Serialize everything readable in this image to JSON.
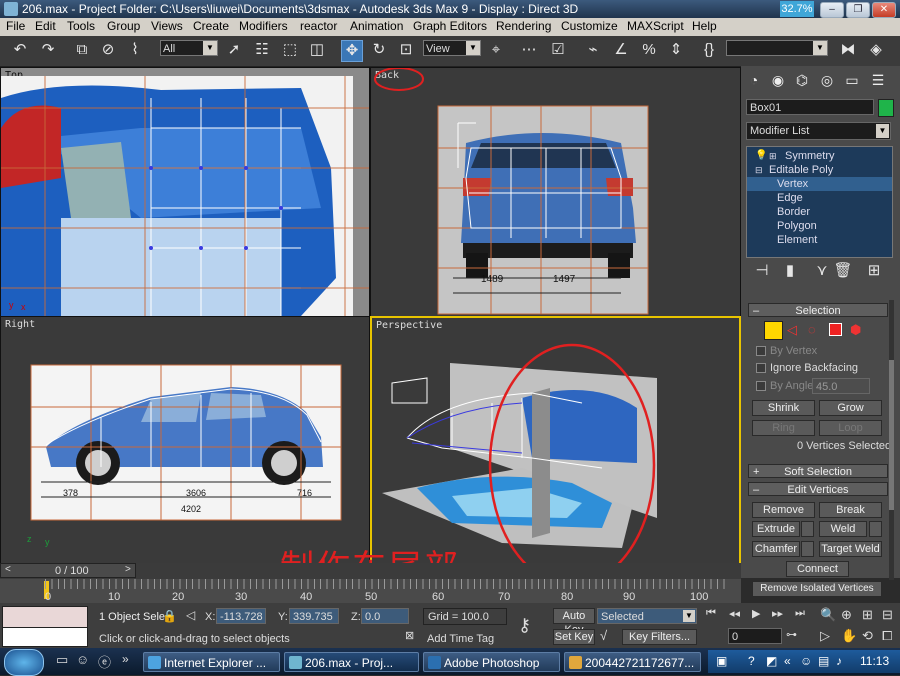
{
  "window": {
    "title": "206.max   - Project Folder: C:\\Users\\liuwei\\Documents\\3dsmax   - Autodesk 3ds Max 9   - Display : Direct 3D",
    "badge": "32.7%"
  },
  "menu": [
    "File",
    "Edit",
    "Tools",
    "Group",
    "Views",
    "Create",
    "Modifiers",
    "reactor",
    "Animation",
    "Graph Editors",
    "Rendering",
    "Customize",
    "MAXScript",
    "Help"
  ],
  "toolbar": {
    "selection_filter": "All",
    "ref_coord": "View",
    "named_selection": ""
  },
  "viewports": {
    "top": {
      "label": "Top"
    },
    "back": {
      "label": "Back",
      "dim_left": "1489",
      "dim_right": "1497"
    },
    "right": {
      "label": "Right",
      "dim_a": "378",
      "dim_b": "3606",
      "dim_c": "716",
      "dim_total": "4202"
    },
    "perspective": {
      "label": "Perspective"
    }
  },
  "annotation": {
    "text": "制作车尾部",
    "color": "#e02020"
  },
  "command_panel": {
    "object_name": "Box01",
    "object_color": "#1fb44a",
    "modifier_list": "Modifier List",
    "stack": [
      "Symmetry",
      "Editable Poly",
      "Vertex",
      "Edge",
      "Border",
      "Polygon",
      "Element"
    ],
    "selection": {
      "title": "Selection",
      "by_vertex": "By Vertex",
      "ignore_backfacing": "Ignore Backfacing",
      "by_angle": "By Angle:",
      "angle_value": "45.0",
      "shrink": "Shrink",
      "grow": "Grow",
      "ring": "Ring",
      "loop": "Loop",
      "status": "0 Vertices Selected"
    },
    "soft_selection": "Soft Selection",
    "edit_vertices": {
      "title": "Edit Vertices",
      "remove": "Remove",
      "break": "Break",
      "extrude": "Extrude",
      "weld": "Weld",
      "chamfer": "Chamfer",
      "target_weld": "Target Weld",
      "connect": "Connect",
      "remove_isolated": "Remove Isolated Vertices"
    }
  },
  "timeline": {
    "frame": "0 / 100",
    "ticks": [
      "0",
      "10",
      "20",
      "30",
      "40",
      "50",
      "60",
      "70",
      "80",
      "90",
      "100"
    ]
  },
  "status": {
    "selected": "1 Object Sele",
    "x_label": "X:",
    "x_value": "-113.728",
    "y_label": "Y:",
    "y_value": "339.735",
    "z_label": "Z:",
    "z_value": "0.0",
    "grid": "Grid = 100.0",
    "prompt": "Click or click-and-drag to select objects",
    "add_time_tag": "Add Time Tag",
    "auto_key": "Auto Key",
    "key_mode": "Selected",
    "set_key": "Set Key",
    "key_filters": "Key Filters...",
    "current_frame": "0"
  },
  "taskbar": {
    "tasks": [
      "Internet Explorer ...",
      "206.max    - Proj...",
      "Adobe Photoshop",
      "200442721172677..."
    ],
    "clock": "11:13"
  }
}
